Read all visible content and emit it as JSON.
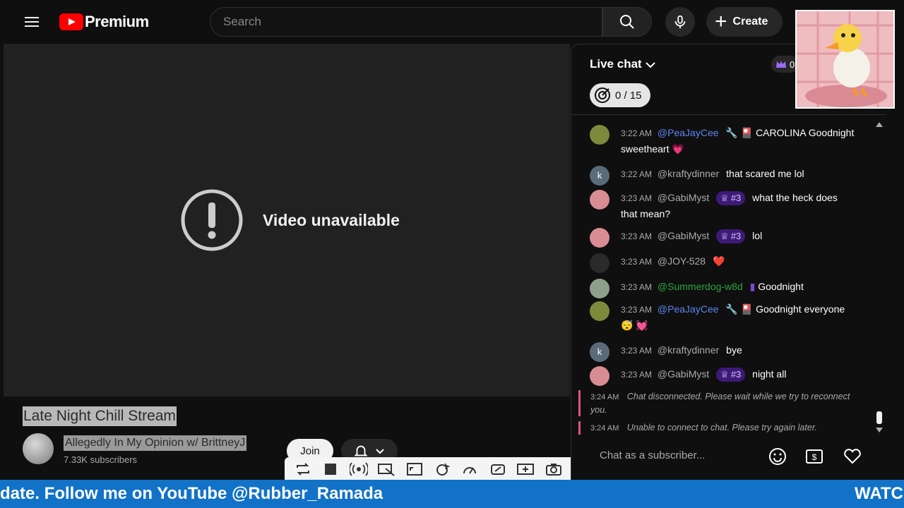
{
  "header": {
    "brand": "Premium",
    "search_placeholder": "Search",
    "create_label": "Create"
  },
  "player": {
    "status": "Video unavailable"
  },
  "video": {
    "title": "Late Night Chill Stream",
    "channel": "Allegedly In My Opinion w/ BrittneyJ",
    "subscribers": "7.33K subscribers",
    "join_label": "Join"
  },
  "chat": {
    "title": "Live chat",
    "goal": "0 / 15",
    "crown_count": "0",
    "input_placeholder": "Chat as a subscriber...",
    "messages": [
      {
        "time": "3:22 AM",
        "author": "@PeaJayCee",
        "text": "CAROLINA Goodnight",
        "text2": "sweetheart",
        "emoji": "💗"
      },
      {
        "time": "3:22 AM",
        "author": "@kraftydinner",
        "text": "that scared me lol",
        "avatar": "k"
      },
      {
        "time": "3:23 AM",
        "author": "@GabiMyst",
        "rank": "#3",
        "text": "what the heck does",
        "text2": "that mean?"
      },
      {
        "time": "3:23 AM",
        "author": "@GabiMyst",
        "rank": "#3",
        "text": "lol"
      },
      {
        "time": "3:23 AM",
        "author": "@JOY-528",
        "emoji": "❤️"
      },
      {
        "time": "3:23 AM",
        "author": "@Summerdog-w8d",
        "text": "Goodnight"
      },
      {
        "time": "3:23 AM",
        "author": "@PeaJayCee",
        "text": "Goodnight everyone",
        "emoji2": "😴 💓"
      },
      {
        "time": "3:23 AM",
        "author": "@kraftydinner",
        "text": "bye",
        "avatar": "k"
      },
      {
        "time": "3:23 AM",
        "author": "@GabiMyst",
        "rank": "#3",
        "text": "night all"
      }
    ],
    "system": [
      {
        "time": "3:24 AM",
        "text": "Chat disconnected. Please wait while we try to reconnect you."
      },
      {
        "time": "3:24 AM",
        "text": "Unable to connect to chat. Please try again later."
      }
    ]
  },
  "ticker": {
    "left_text": "date. Follow me on YouTube @Rubber_Ramada",
    "right_text": "WATC"
  },
  "colors": {
    "ticker_bg": "#1272c8",
    "accent_red": "#ff0000",
    "rank_bg": "#3d1a78"
  }
}
